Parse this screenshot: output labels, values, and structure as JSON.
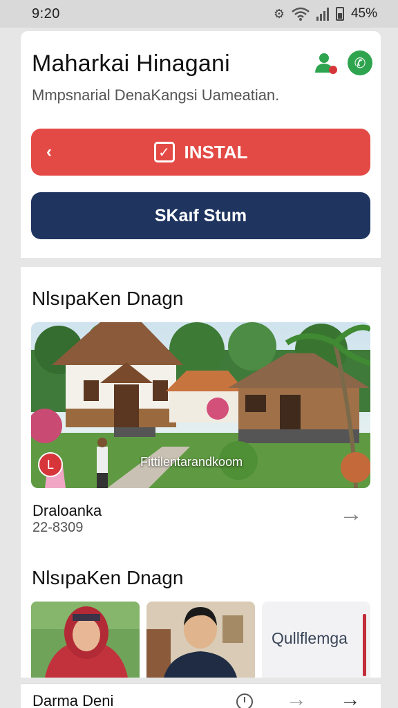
{
  "status_bar": {
    "time": "9:20",
    "battery": "45%",
    "icons": [
      "settings-icon",
      "wifi-icon",
      "signal-icon",
      "battery-icon"
    ]
  },
  "header": {
    "title": "Maharkai Hinagani",
    "subtitle": "Mmpsnarial DenaKangsi Uameatian.",
    "icons": [
      "user-location-icon",
      "phone-icon"
    ]
  },
  "buttons": {
    "install_back": "‹",
    "install_label": "INSTAL",
    "start_label": "SKaıf Stum"
  },
  "section1": {
    "title": "NlsıpaKen Dnagn",
    "image_caption": "Fittilentarandkoom",
    "badge_letter": "L",
    "item_name": "Draloanka",
    "item_code": "22-8309"
  },
  "section2": {
    "title": "NlsıpaKen Dnagn",
    "thumb3_label": "Qullflemga"
  },
  "bottom_bar": {
    "name": "Darma Deni"
  },
  "colors": {
    "install": "#e34a45",
    "start": "#1f3560",
    "phone": "#2ea44f",
    "accent": "#c32c3a"
  }
}
